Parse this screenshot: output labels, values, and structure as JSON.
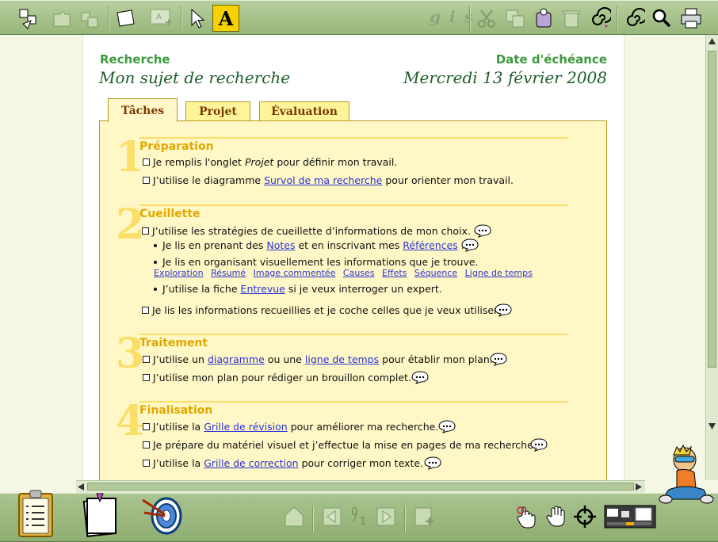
{
  "header": {
    "left_label": "Recherche",
    "left_title": "Mon sujet de recherche",
    "right_label": "Date d'échéance",
    "right_title": "Mercredi 13 février 2008"
  },
  "toolbar": {
    "letter_button": "A",
    "format_letters": "g i s"
  },
  "tabs": [
    {
      "label": "Tâches",
      "active": true
    },
    {
      "label": "Projet",
      "active": false
    },
    {
      "label": "Évaluation",
      "active": false
    }
  ],
  "sections": {
    "s1": {
      "number": "1",
      "title": "Préparation",
      "t1": {
        "before": "Je remplis l'onglet ",
        "italic": "Projet",
        "after": " pour définir mon travail."
      },
      "t2": {
        "before": "J’utilise le diagramme ",
        "link": "Survol de ma recherche",
        "after": " pour orienter mon travail."
      }
    },
    "s2": {
      "number": "2",
      "title": "Cueillette",
      "t1": {
        "text": "J’utilise les stratégies de cueillette d’informations de mon choix."
      },
      "b1": {
        "before": "Je lis en prenant des ",
        "link1": "Notes",
        "mid": " et en inscrivant mes ",
        "link2": "Références",
        "after": "."
      },
      "b2": {
        "text": "Je lis en organisant visuellement les informations que je trouve."
      },
      "links": [
        "Exploration",
        "Résumé",
        "Image commentée",
        "Causes",
        "Effets",
        "Séquence",
        "Ligne de temps"
      ],
      "b3": {
        "before": "J’utilise la fiche ",
        "link": "Entrevue",
        "after": " si je veux interroger un expert."
      },
      "t2": {
        "text": "Je lis les informations recueillies et je coche celles que je veux utiliser."
      }
    },
    "s3": {
      "number": "3",
      "title": "Traitement",
      "t1": {
        "before": "J’utilise un ",
        "link1": "diagramme",
        "mid": " ou une ",
        "link2": "ligne de temps",
        "after": " pour établir mon plan."
      },
      "t2": {
        "text": "J’utilise mon plan pour rédiger un brouillon complet."
      }
    },
    "s4": {
      "number": "4",
      "title": "Finalisation",
      "t1": {
        "before": "J’utilise la ",
        "link": "Grille de révision",
        "after": " pour améliorer ma recherche."
      },
      "t2": {
        "text": "Je prépare du matériel visuel et j’effectue la mise en pages de ma recherche."
      },
      "t3": {
        "before": "J’utilise la ",
        "link": "Grille de correction",
        "after": " pour corriger mon texte."
      }
    }
  },
  "bottombar": {
    "page_current": "0",
    "page_total": "1"
  },
  "colors": {
    "accent_green": "#3d9a3d",
    "section_yellow": "#e0a800",
    "link_blue": "#2b34d6",
    "panel_bg": "#fff7c6"
  }
}
